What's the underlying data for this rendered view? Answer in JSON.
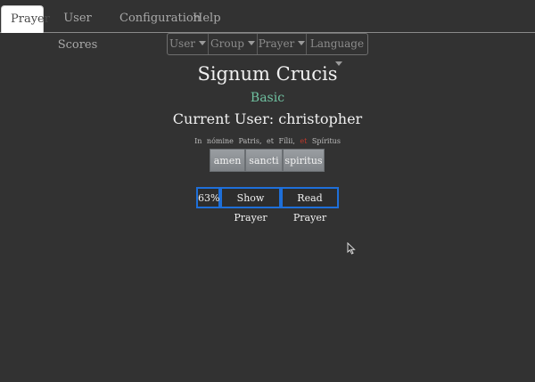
{
  "tabs": [
    "Prayer",
    "User Scores",
    "Configuration",
    "Help"
  ],
  "nav": {
    "user": "User",
    "group": "Group",
    "prayer": "Prayer",
    "language": "Language"
  },
  "prayer": {
    "title": "Signum Crucis",
    "level": "Basic",
    "current_user": "Current User: christopher",
    "text_before": "In nómine Patris, et Fílii,",
    "text_red": "et",
    "text_after": "Spíritus",
    "choices": [
      "amen",
      "sancti",
      "spiritus"
    ]
  },
  "actions": {
    "score": "63%",
    "show": "Show Prayer",
    "read": "Read Prayer"
  },
  "colors": {
    "background": "#323232",
    "accent_green": "#6fc0a0",
    "accent_blue": "#1e6fd9",
    "highlight_red": "#c0392b"
  }
}
